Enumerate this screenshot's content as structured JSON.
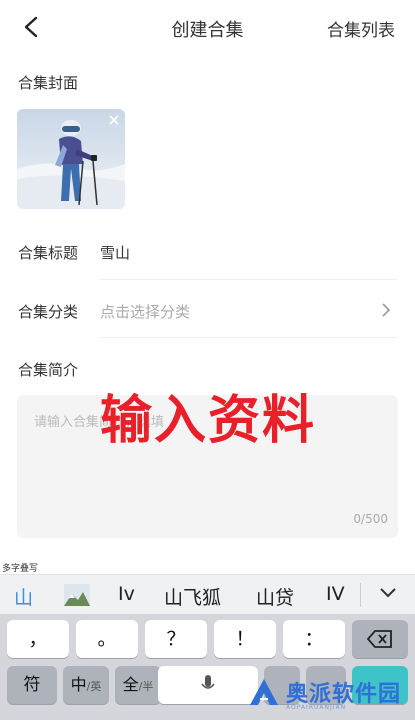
{
  "header": {
    "title": "创建合集",
    "list_link": "合集列表"
  },
  "cover": {
    "label": "合集封面"
  },
  "form": {
    "title_label": "合集标题",
    "title_value": "雪山",
    "category_label": "合集分类",
    "category_placeholder": "点击选择分类",
    "intro_label": "合集简介",
    "intro_placeholder": "请输入合集简介，选填",
    "intro_counter": "0/500"
  },
  "overlay_text": "输入资料",
  "keyboard": {
    "multi_hint": "多字叠写",
    "candidates": [
      "山",
      "Iv",
      "山飞狐",
      "山贷",
      "IV"
    ],
    "row1": [
      "，",
      "。",
      "？",
      "！",
      "："
    ],
    "row2": {
      "sym": "符",
      "zh": "中",
      "zh_sub": "/英",
      "full": "全",
      "full_sub": "/半"
    }
  },
  "watermark": {
    "text": "奥派软件园",
    "sub": "AOPAIRUANJIAN"
  },
  "colors": {
    "accent_blue": "#3a8fe6",
    "overlay_red": "#e8202a",
    "watermark_blue": "#2f6fd6"
  }
}
